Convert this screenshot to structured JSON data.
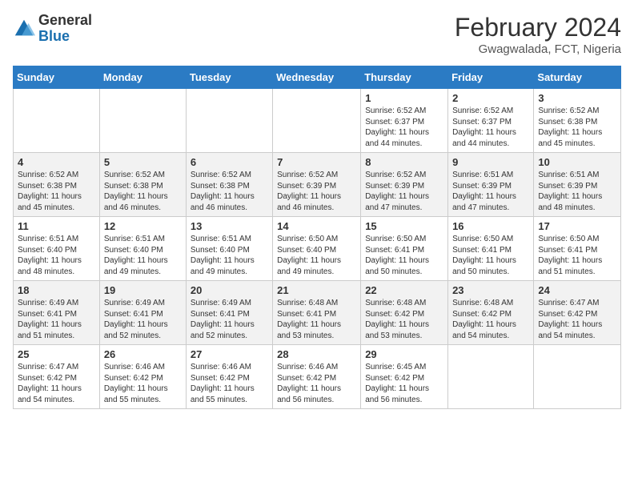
{
  "header": {
    "logo_general": "General",
    "logo_blue": "Blue",
    "title": "February 2024",
    "subtitle": "Gwagwalada, FCT, Nigeria"
  },
  "weekdays": [
    "Sunday",
    "Monday",
    "Tuesday",
    "Wednesday",
    "Thursday",
    "Friday",
    "Saturday"
  ],
  "weeks": [
    [
      {
        "day": "",
        "info": ""
      },
      {
        "day": "",
        "info": ""
      },
      {
        "day": "",
        "info": ""
      },
      {
        "day": "",
        "info": ""
      },
      {
        "day": "1",
        "info": "Sunrise: 6:52 AM\nSunset: 6:37 PM\nDaylight: 11 hours and 44 minutes."
      },
      {
        "day": "2",
        "info": "Sunrise: 6:52 AM\nSunset: 6:37 PM\nDaylight: 11 hours and 44 minutes."
      },
      {
        "day": "3",
        "info": "Sunrise: 6:52 AM\nSunset: 6:38 PM\nDaylight: 11 hours and 45 minutes."
      }
    ],
    [
      {
        "day": "4",
        "info": "Sunrise: 6:52 AM\nSunset: 6:38 PM\nDaylight: 11 hours and 45 minutes."
      },
      {
        "day": "5",
        "info": "Sunrise: 6:52 AM\nSunset: 6:38 PM\nDaylight: 11 hours and 46 minutes."
      },
      {
        "day": "6",
        "info": "Sunrise: 6:52 AM\nSunset: 6:38 PM\nDaylight: 11 hours and 46 minutes."
      },
      {
        "day": "7",
        "info": "Sunrise: 6:52 AM\nSunset: 6:39 PM\nDaylight: 11 hours and 46 minutes."
      },
      {
        "day": "8",
        "info": "Sunrise: 6:52 AM\nSunset: 6:39 PM\nDaylight: 11 hours and 47 minutes."
      },
      {
        "day": "9",
        "info": "Sunrise: 6:51 AM\nSunset: 6:39 PM\nDaylight: 11 hours and 47 minutes."
      },
      {
        "day": "10",
        "info": "Sunrise: 6:51 AM\nSunset: 6:39 PM\nDaylight: 11 hours and 48 minutes."
      }
    ],
    [
      {
        "day": "11",
        "info": "Sunrise: 6:51 AM\nSunset: 6:40 PM\nDaylight: 11 hours and 48 minutes."
      },
      {
        "day": "12",
        "info": "Sunrise: 6:51 AM\nSunset: 6:40 PM\nDaylight: 11 hours and 49 minutes."
      },
      {
        "day": "13",
        "info": "Sunrise: 6:51 AM\nSunset: 6:40 PM\nDaylight: 11 hours and 49 minutes."
      },
      {
        "day": "14",
        "info": "Sunrise: 6:50 AM\nSunset: 6:40 PM\nDaylight: 11 hours and 49 minutes."
      },
      {
        "day": "15",
        "info": "Sunrise: 6:50 AM\nSunset: 6:41 PM\nDaylight: 11 hours and 50 minutes."
      },
      {
        "day": "16",
        "info": "Sunrise: 6:50 AM\nSunset: 6:41 PM\nDaylight: 11 hours and 50 minutes."
      },
      {
        "day": "17",
        "info": "Sunrise: 6:50 AM\nSunset: 6:41 PM\nDaylight: 11 hours and 51 minutes."
      }
    ],
    [
      {
        "day": "18",
        "info": "Sunrise: 6:49 AM\nSunset: 6:41 PM\nDaylight: 11 hours and 51 minutes."
      },
      {
        "day": "19",
        "info": "Sunrise: 6:49 AM\nSunset: 6:41 PM\nDaylight: 11 hours and 52 minutes."
      },
      {
        "day": "20",
        "info": "Sunrise: 6:49 AM\nSunset: 6:41 PM\nDaylight: 11 hours and 52 minutes."
      },
      {
        "day": "21",
        "info": "Sunrise: 6:48 AM\nSunset: 6:41 PM\nDaylight: 11 hours and 53 minutes."
      },
      {
        "day": "22",
        "info": "Sunrise: 6:48 AM\nSunset: 6:42 PM\nDaylight: 11 hours and 53 minutes."
      },
      {
        "day": "23",
        "info": "Sunrise: 6:48 AM\nSunset: 6:42 PM\nDaylight: 11 hours and 54 minutes."
      },
      {
        "day": "24",
        "info": "Sunrise: 6:47 AM\nSunset: 6:42 PM\nDaylight: 11 hours and 54 minutes."
      }
    ],
    [
      {
        "day": "25",
        "info": "Sunrise: 6:47 AM\nSunset: 6:42 PM\nDaylight: 11 hours and 54 minutes."
      },
      {
        "day": "26",
        "info": "Sunrise: 6:46 AM\nSunset: 6:42 PM\nDaylight: 11 hours and 55 minutes."
      },
      {
        "day": "27",
        "info": "Sunrise: 6:46 AM\nSunset: 6:42 PM\nDaylight: 11 hours and 55 minutes."
      },
      {
        "day": "28",
        "info": "Sunrise: 6:46 AM\nSunset: 6:42 PM\nDaylight: 11 hours and 56 minutes."
      },
      {
        "day": "29",
        "info": "Sunrise: 6:45 AM\nSunset: 6:42 PM\nDaylight: 11 hours and 56 minutes."
      },
      {
        "day": "",
        "info": ""
      },
      {
        "day": "",
        "info": ""
      }
    ]
  ]
}
